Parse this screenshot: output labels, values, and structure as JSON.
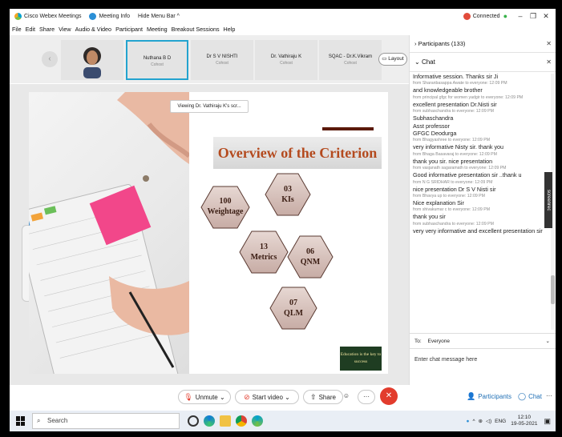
{
  "titlebar": {
    "app_title": "Cisco Webex Meetings",
    "meeting_info": "Meeting Info",
    "hide_menu": "Hide Menu Bar ^",
    "status": "Connected"
  },
  "menu": [
    "File",
    "Edit",
    "Share",
    "View",
    "Audio & Video",
    "Participant",
    "Meeting",
    "Breakout Sessions",
    "Help"
  ],
  "strip": {
    "tiles": [
      {
        "name": "Nuthana B D",
        "role": "Cohost"
      },
      {
        "name": "Dr S V NISHTI",
        "role": "Cohost"
      },
      {
        "name": "Dr. Vathiraju K",
        "role": "Cohost"
      },
      {
        "name": "SQAC - Dr.K.Vikram",
        "role": "Cohost"
      }
    ],
    "layout_label": "Layout"
  },
  "share": {
    "viewing_tip": "Viewing Dr. Vathiraju K's scr...",
    "slide_title": "Overview of the Criterion",
    "hexes": [
      {
        "num": "100",
        "label": "Weightage"
      },
      {
        "num": "03",
        "label": "KIs"
      },
      {
        "num": "13",
        "label": "Metrics"
      },
      {
        "num": "06",
        "label": "QNM"
      },
      {
        "num": "07",
        "label": "QLM"
      }
    ],
    "badge": "Education is the key to success"
  },
  "panel": {
    "participants_label": "Participants (133)",
    "chat_label": "Chat",
    "messages": [
      {
        "text": "Informative session. Thanks sir Ji"
      },
      {
        "meta": "from Sharanbasappa Awate to everyone:   12:09 PM",
        "text": "and knowledgeable brother"
      },
      {
        "meta": "from principal gfgc for women yadgir to everyone:   12:09 PM",
        "text": "excellent presentation Dr.Nisti sir"
      },
      {
        "meta": "from subhaschandra to everyone:   12:09 PM",
        "text": "Subhaschandra"
      },
      {
        "text": "Asst professor"
      },
      {
        "text": "GFGC Deodurga"
      },
      {
        "meta": "from Bhagyashree to everyone:   12:09 PM",
        "text": "very informative Nisty sir. thank you"
      },
      {
        "meta": "from Bhaga Basavaraj to everyone:   12:09 PM",
        "text": "thank  you  sir.  nice presentation"
      },
      {
        "meta": "from vasjanath sagaramath to everyone:   12:09 PM",
        "text": "Good informative presentation sir ..thank u"
      },
      {
        "meta": "from N G SRIDHAR to everyone:   12:09 PM",
        "text": "nice presentation Dr S V Nisti sir"
      },
      {
        "meta": "from Bhavya up to everyone:   12:09 PM",
        "text": "Nice explanation Sir"
      },
      {
        "meta": "from shivakumar c to everyone:   12:09 PM",
        "text": "thank you sir"
      },
      {
        "meta": "from subhaschandra to everyone:   12:09 PM",
        "text": "very very informative and excellent presentation sir"
      }
    ],
    "to_label": "To:",
    "to_value": "Everyone",
    "input_placeholder": "Enter chat message here"
  },
  "controls": {
    "unmute": "Unmute",
    "start_video": "Start video",
    "share": "Share",
    "participants": "Participants",
    "chat": "Chat"
  },
  "taskbar": {
    "search": "Search",
    "lang": "ENG",
    "time": "12:10",
    "date": "19-05-2021"
  },
  "screenrec": "screenrec"
}
